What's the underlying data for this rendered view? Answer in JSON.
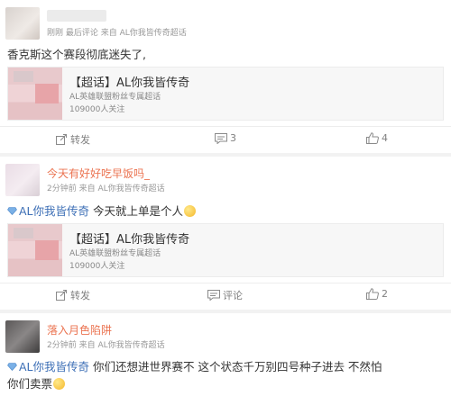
{
  "posts": [
    {
      "meta": "刚刚 最后评论 来自 AL你我皆传奇超话",
      "text": "香克斯这个赛段彻底迷失了,",
      "share": {
        "title": "【超话】AL你我皆传奇",
        "subtitle": "AL英雄联盟粉丝专属超话",
        "followers": "109000人关注"
      },
      "actions": {
        "repost": "转发",
        "comment": "3",
        "like": "4"
      }
    },
    {
      "author": "今天有好好吃早饭吗_",
      "meta": "2分钟前 来自 AL你我皆传奇超话",
      "topic": "AL你我皆传奇",
      "text": " 今天就上单是个人",
      "share": {
        "title": "【超话】AL你我皆传奇",
        "subtitle": "AL英雄联盟粉丝专属超话",
        "followers": "109000人关注"
      },
      "actions": {
        "repost": "转发",
        "comment": "评论",
        "like": "2"
      }
    },
    {
      "author": "落入月色陷阱",
      "meta": "2分钟前 来自 AL你我皆传奇超话",
      "topic": "AL你我皆传奇",
      "text": " 你们还想进世界赛不 这个状态千万别四号种子进去 不然怕",
      "text2": "你们卖票"
    }
  ],
  "colors": {
    "author": "#eb7350",
    "topic": "#3d6fb6",
    "meta": "#999999"
  }
}
